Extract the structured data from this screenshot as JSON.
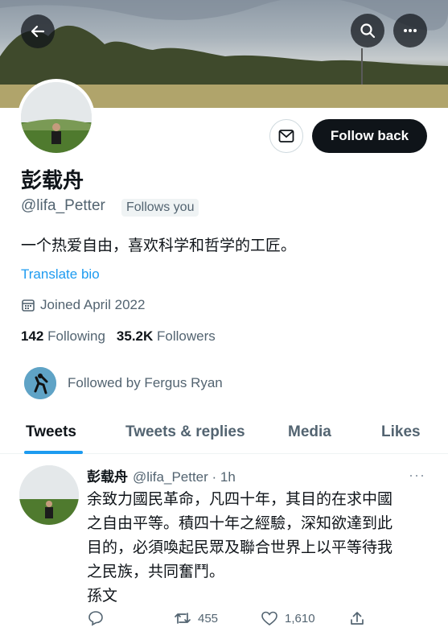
{
  "profile": {
    "name": "彭载舟",
    "handle": "@lifa_Petter",
    "follows_you": "Follows you",
    "bio": "一个热爱自由，喜欢科学和哲学的工匠。",
    "translate_bio": "Translate bio",
    "joined": "Joined April 2022",
    "following_count": "142",
    "following_label": "Following",
    "followers_count": "35.2K",
    "followers_label": "Followers",
    "followed_by": "Followed by Fergus Ryan"
  },
  "buttons": {
    "follow_back": "Follow back"
  },
  "tabs": [
    {
      "label": "Tweets"
    },
    {
      "label": "Tweets & replies"
    },
    {
      "label": "Media"
    },
    {
      "label": "Likes"
    }
  ],
  "tweet": {
    "name": "彭载舟",
    "handle_time": "@lifa_Petter · 1h",
    "text": "余致力國民革命，凡四十年，其目的在求中國\n之自由平等。積四十年之經驗，深知欲達到此\n目的，必須喚起民眾及聯合世界上以平等待我\n之民族，共同奮鬥。\n孫文",
    "more": "···",
    "retweets": "455",
    "likes": "1,610"
  },
  "colors": {
    "accent": "#1d9bf0",
    "text_primary": "#0f1419",
    "text_secondary": "#536471"
  },
  "icons": [
    "back-arrow-icon",
    "search-icon",
    "more-icon",
    "mail-icon",
    "calendar-icon",
    "reply-icon",
    "retweet-icon",
    "like-icon",
    "share-icon"
  ]
}
